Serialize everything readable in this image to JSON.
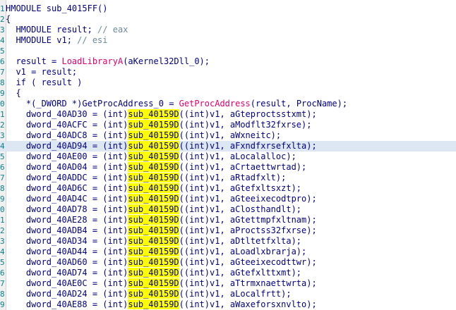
{
  "lines": [
    {
      "n": "1",
      "t": [
        {
          "c": "kw",
          "v": "HMODULE sub_4015FF()"
        }
      ]
    },
    {
      "n": "2",
      "t": [
        {
          "c": "kw",
          "v": "{"
        }
      ]
    },
    {
      "n": "3",
      "t": [
        {
          "c": "kw",
          "v": "  HMODULE result; "
        },
        {
          "c": "cm",
          "v": "// eax"
        }
      ]
    },
    {
      "n": "4",
      "t": [
        {
          "c": "kw",
          "v": "  HMODULE v1; "
        },
        {
          "c": "cm",
          "v": "// esi"
        }
      ]
    },
    {
      "n": "5",
      "t": []
    },
    {
      "n": "6",
      "t": [
        {
          "c": "kw",
          "v": "  result = "
        },
        {
          "c": "fn",
          "v": "LoadLibraryA"
        },
        {
          "c": "kw",
          "v": "(aKernel32Dll_0);"
        }
      ]
    },
    {
      "n": "7",
      "t": [
        {
          "c": "kw",
          "v": "  v1 = result;"
        }
      ]
    },
    {
      "n": "8",
      "t": [
        {
          "c": "kw",
          "v": "  if ( result )"
        }
      ]
    },
    {
      "n": "9",
      "t": [
        {
          "c": "kw",
          "v": "  {"
        }
      ]
    },
    {
      "n": "0",
      "t": [
        {
          "c": "kw",
          "v": "    *(_DWORD *)GetProcAddress_0 = "
        },
        {
          "c": "fn",
          "v": "GetProcAddress"
        },
        {
          "c": "kw",
          "v": "(result, ProcName);"
        }
      ]
    },
    {
      "n": "1",
      "t": [
        {
          "c": "kw",
          "v": "    dword_40AD30 = (int)"
        },
        {
          "c": "ysub",
          "v": "sub_40159D"
        },
        {
          "c": "kw",
          "v": "((int)v1, aGteproctsstxmt);"
        }
      ]
    },
    {
      "n": "2",
      "t": [
        {
          "c": "kw",
          "v": "    dword_40ACFC = (int)"
        },
        {
          "c": "ysub",
          "v": "sub_40159D"
        },
        {
          "c": "kw",
          "v": "((int)v1, aModflt32fxrse);"
        }
      ]
    },
    {
      "n": "3",
      "t": [
        {
          "c": "kw",
          "v": "    dword_40ADC8 = (int)"
        },
        {
          "c": "ysub",
          "v": "sub_40159D"
        },
        {
          "c": "kw",
          "v": "((int)v1, aWxneitc);"
        }
      ]
    },
    {
      "n": "4",
      "hl": true,
      "t": [
        {
          "c": "kw",
          "v": "    dword_40AD94 = (int)"
        },
        {
          "c": "ysub",
          "v": "sub_40159D"
        },
        {
          "c": "kw",
          "v": "((int)v1, aFxndfxrsefxlta);"
        }
      ]
    },
    {
      "n": "5",
      "t": [
        {
          "c": "kw",
          "v": "    dword_40AE00 = (int)"
        },
        {
          "c": "ysub",
          "v": "sub_40159D"
        },
        {
          "c": "kw",
          "v": "((int)v1, aLocalalloc);"
        }
      ]
    },
    {
      "n": "6",
      "t": [
        {
          "c": "kw",
          "v": "    dword_40AD04 = (int)"
        },
        {
          "c": "ysub",
          "v": "sub_40159D"
        },
        {
          "c": "kw",
          "v": "((int)v1, aCrtaettwrtad);"
        }
      ]
    },
    {
      "n": "7",
      "t": [
        {
          "c": "kw",
          "v": "    dword_40ADDC = (int)"
        },
        {
          "c": "ysub",
          "v": "sub_40159D"
        },
        {
          "c": "kw",
          "v": "((int)v1, aRtadfxlt);"
        }
      ]
    },
    {
      "n": "8",
      "t": [
        {
          "c": "kw",
          "v": "    dword_40AD6C = (int)"
        },
        {
          "c": "ysub",
          "v": "sub_40159D"
        },
        {
          "c": "kw",
          "v": "((int)v1, aGtefxltsxzt);"
        }
      ]
    },
    {
      "n": "9",
      "t": [
        {
          "c": "kw",
          "v": "    dword_40AD4C = (int)"
        },
        {
          "c": "ysub",
          "v": "sub_40159D"
        },
        {
          "c": "kw",
          "v": "((int)v1, aGteeixecodtpro);"
        }
      ]
    },
    {
      "n": "0",
      "t": [
        {
          "c": "kw",
          "v": "    dword_40AD78 = (int)"
        },
        {
          "c": "ysub",
          "v": "sub_40159D"
        },
        {
          "c": "kw",
          "v": "((int)v1, aClosthandlt);"
        }
      ]
    },
    {
      "n": "1",
      "t": [
        {
          "c": "kw",
          "v": "    dword_40AE28 = (int)"
        },
        {
          "c": "ysub",
          "v": "sub_40159D"
        },
        {
          "c": "kw",
          "v": "((int)v1, aGtettmpfxltnam);"
        }
      ]
    },
    {
      "n": "2",
      "t": [
        {
          "c": "kw",
          "v": "    dword_40ADB4 = (int)"
        },
        {
          "c": "ysub",
          "v": "sub_40159D"
        },
        {
          "c": "kw",
          "v": "((int)v1, aProctss32fxrse);"
        }
      ]
    },
    {
      "n": "3",
      "t": [
        {
          "c": "kw",
          "v": "    dword_40AD34 = (int)"
        },
        {
          "c": "ysub",
          "v": "sub_40159D"
        },
        {
          "c": "kw",
          "v": "((int)v1, aDtltetfxlta);"
        }
      ]
    },
    {
      "n": "4",
      "t": [
        {
          "c": "kw",
          "v": "    dword_40AD44 = (int)"
        },
        {
          "c": "ysub",
          "v": "sub_40159D"
        },
        {
          "c": "kw",
          "v": "((int)v1, aLoadlxbrarja);"
        }
      ]
    },
    {
      "n": "5",
      "t": [
        {
          "c": "kw",
          "v": "    dword_40AD60 = (int)"
        },
        {
          "c": "ysub",
          "v": "sub_40159D"
        },
        {
          "c": "kw",
          "v": "((int)v1, aGteeixecodttwr);"
        }
      ]
    },
    {
      "n": "6",
      "t": [
        {
          "c": "kw",
          "v": "    dword_40AD74 = (int)"
        },
        {
          "c": "ysub",
          "v": "sub_40159D"
        },
        {
          "c": "kw",
          "v": "((int)v1, aGtefxlttxmt);"
        }
      ]
    },
    {
      "n": "7",
      "t": [
        {
          "c": "kw",
          "v": "    dword_40AE0C = (int)"
        },
        {
          "c": "ysub",
          "v": "sub_40159D"
        },
        {
          "c": "kw",
          "v": "((int)v1, aTtrmxnaettwrta);"
        }
      ]
    },
    {
      "n": "8",
      "t": [
        {
          "c": "kw",
          "v": "    dword_40AD24 = (int)"
        },
        {
          "c": "ysub",
          "v": "sub_40159D"
        },
        {
          "c": "kw",
          "v": "((int)v1, aLocalfrtt);"
        }
      ]
    },
    {
      "n": "9",
      "t": [
        {
          "c": "kw",
          "v": "    dword_40AE88 = (int)"
        },
        {
          "c": "ysub",
          "v": "sub_40159D"
        },
        {
          "c": "kw",
          "v": "((int)v1, aWaxeforsxnvlto);"
        }
      ]
    }
  ]
}
